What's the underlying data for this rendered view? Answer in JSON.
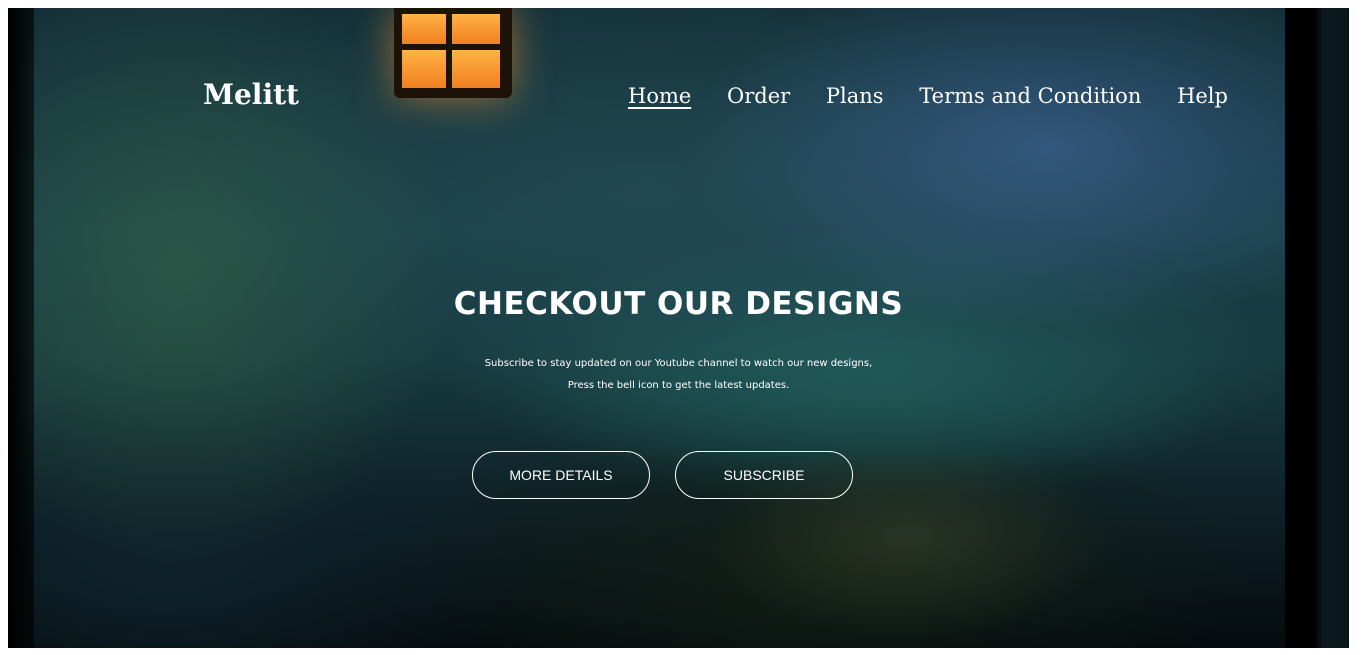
{
  "brand": {
    "name": "Melitt"
  },
  "nav": {
    "items": [
      {
        "label": "Home",
        "active": true
      },
      {
        "label": "Order"
      },
      {
        "label": "Plans"
      },
      {
        "label": "Terms and Condition"
      },
      {
        "label": "Help"
      }
    ]
  },
  "hero": {
    "headline": "CHECKOUT OUR DESIGNS",
    "subtitle_line1": "Subscribe to stay updated on our Youtube channel to watch our new designs,",
    "subtitle_line2": "Press the bell icon to get the latest updates.",
    "buttons": {
      "more_details": "MORE DETAILS",
      "subscribe": "SUBSCRIBE"
    },
    "background_image": "night forest with hanging lantern"
  },
  "colors": {
    "text": "#ffffff",
    "lantern_glow": "#ffb347"
  }
}
